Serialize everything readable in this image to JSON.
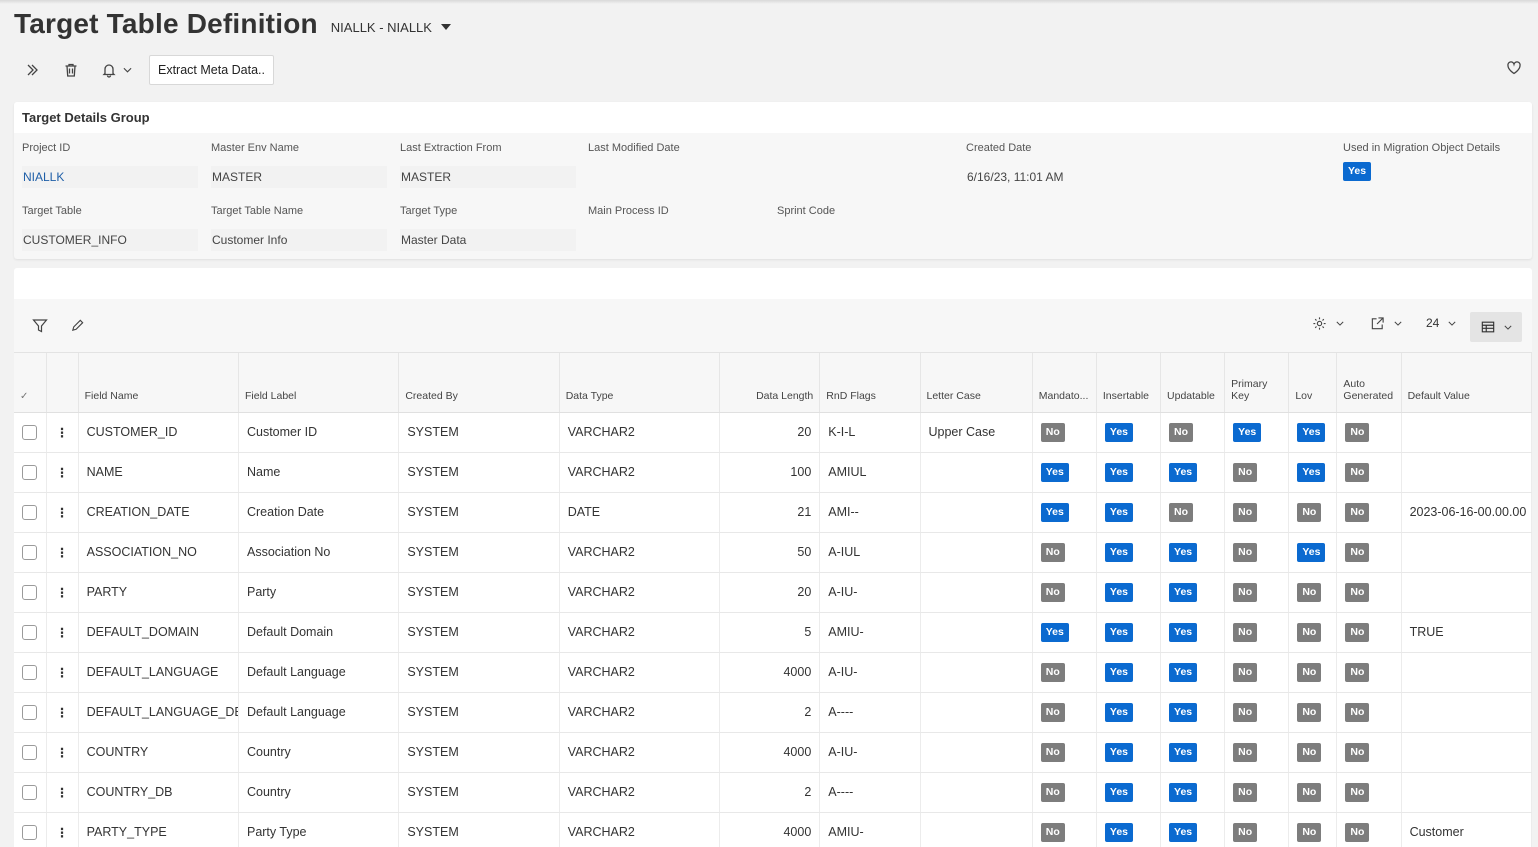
{
  "header": {
    "title": "Target Table Definition",
    "record": "NIALLK - NIALLK"
  },
  "toolbar": {
    "extract_label": "Extract Meta Data.."
  },
  "details": {
    "group_title": "Target Details Group",
    "fields": {
      "project_id": {
        "label": "Project ID",
        "value": "NIALLK"
      },
      "master_env": {
        "label": "Master Env Name",
        "value": "MASTER"
      },
      "last_extraction": {
        "label": "Last Extraction From",
        "value": "MASTER"
      },
      "last_modified": {
        "label": "Last Modified Date",
        "value": ""
      },
      "created_date": {
        "label": "Created Date",
        "value": "6/16/23, 11:01 AM"
      },
      "used_in_migration": {
        "label": "Used in Migration Object Details",
        "value": "Yes"
      },
      "target_table": {
        "label": "Target Table",
        "value": "CUSTOMER_INFO"
      },
      "target_table_name": {
        "label": "Target Table Name",
        "value": "Customer Info"
      },
      "target_type": {
        "label": "Target Type",
        "value": "Master Data"
      },
      "main_process_id": {
        "label": "Main Process ID",
        "value": ""
      },
      "sprint_code": {
        "label": "Sprint Code",
        "value": ""
      }
    }
  },
  "list": {
    "page_size": "24",
    "columns": {
      "field_name": "Field Name",
      "field_label": "Field Label",
      "created_by": "Created By",
      "data_type": "Data Type",
      "data_length": "Data Length",
      "rnd_flags": "RnD Flags",
      "letter_case": "Letter Case",
      "mandatory": "Mandato...",
      "insertable": "Insertable",
      "updatable": "Updatable",
      "primary_key": "Primary Key",
      "lov": "Lov",
      "auto_generated": "Auto Generated",
      "default_value": "Default Value"
    },
    "rows": [
      {
        "field_name": "CUSTOMER_ID",
        "field_label": "Customer ID",
        "created_by": "SYSTEM",
        "data_type": "VARCHAR2",
        "data_length": "20",
        "rnd_flags": "K-I-L",
        "letter_case": "Upper Case",
        "mandatory": "No",
        "insertable": "Yes",
        "updatable": "No",
        "primary_key": "Yes",
        "lov": "Yes",
        "auto_generated": "No",
        "default_value": ""
      },
      {
        "field_name": "NAME",
        "field_label": "Name",
        "created_by": "SYSTEM",
        "data_type": "VARCHAR2",
        "data_length": "100",
        "rnd_flags": "AMIUL",
        "letter_case": "",
        "mandatory": "Yes",
        "insertable": "Yes",
        "updatable": "Yes",
        "primary_key": "No",
        "lov": "Yes",
        "auto_generated": "No",
        "default_value": ""
      },
      {
        "field_name": "CREATION_DATE",
        "field_label": "Creation Date",
        "created_by": "SYSTEM",
        "data_type": "DATE",
        "data_length": "21",
        "rnd_flags": "AMI--",
        "letter_case": "",
        "mandatory": "Yes",
        "insertable": "Yes",
        "updatable": "No",
        "primary_key": "No",
        "lov": "No",
        "auto_generated": "No",
        "default_value": "2023-06-16-00.00.00"
      },
      {
        "field_name": "ASSOCIATION_NO",
        "field_label": "Association No",
        "created_by": "SYSTEM",
        "data_type": "VARCHAR2",
        "data_length": "50",
        "rnd_flags": "A-IUL",
        "letter_case": "",
        "mandatory": "No",
        "insertable": "Yes",
        "updatable": "Yes",
        "primary_key": "No",
        "lov": "Yes",
        "auto_generated": "No",
        "default_value": ""
      },
      {
        "field_name": "PARTY",
        "field_label": "Party",
        "created_by": "SYSTEM",
        "data_type": "VARCHAR2",
        "data_length": "20",
        "rnd_flags": "A-IU-",
        "letter_case": "",
        "mandatory": "No",
        "insertable": "Yes",
        "updatable": "Yes",
        "primary_key": "No",
        "lov": "No",
        "auto_generated": "No",
        "default_value": ""
      },
      {
        "field_name": "DEFAULT_DOMAIN",
        "field_label": "Default Domain",
        "created_by": "SYSTEM",
        "data_type": "VARCHAR2",
        "data_length": "5",
        "rnd_flags": "AMIU-",
        "letter_case": "",
        "mandatory": "Yes",
        "insertable": "Yes",
        "updatable": "Yes",
        "primary_key": "No",
        "lov": "No",
        "auto_generated": "No",
        "default_value": "TRUE"
      },
      {
        "field_name": "DEFAULT_LANGUAGE",
        "field_label": "Default Language",
        "created_by": "SYSTEM",
        "data_type": "VARCHAR2",
        "data_length": "4000",
        "rnd_flags": "A-IU-",
        "letter_case": "",
        "mandatory": "No",
        "insertable": "Yes",
        "updatable": "Yes",
        "primary_key": "No",
        "lov": "No",
        "auto_generated": "No",
        "default_value": ""
      },
      {
        "field_name": "DEFAULT_LANGUAGE_DB",
        "field_label": "Default Language",
        "created_by": "SYSTEM",
        "data_type": "VARCHAR2",
        "data_length": "2",
        "rnd_flags": "A----",
        "letter_case": "",
        "mandatory": "No",
        "insertable": "Yes",
        "updatable": "Yes",
        "primary_key": "No",
        "lov": "No",
        "auto_generated": "No",
        "default_value": ""
      },
      {
        "field_name": "COUNTRY",
        "field_label": "Country",
        "created_by": "SYSTEM",
        "data_type": "VARCHAR2",
        "data_length": "4000",
        "rnd_flags": "A-IU-",
        "letter_case": "",
        "mandatory": "No",
        "insertable": "Yes",
        "updatable": "Yes",
        "primary_key": "No",
        "lov": "No",
        "auto_generated": "No",
        "default_value": ""
      },
      {
        "field_name": "COUNTRY_DB",
        "field_label": "Country",
        "created_by": "SYSTEM",
        "data_type": "VARCHAR2",
        "data_length": "2",
        "rnd_flags": "A----",
        "letter_case": "",
        "mandatory": "No",
        "insertable": "Yes",
        "updatable": "Yes",
        "primary_key": "No",
        "lov": "No",
        "auto_generated": "No",
        "default_value": ""
      },
      {
        "field_name": "PARTY_TYPE",
        "field_label": "Party Type",
        "created_by": "SYSTEM",
        "data_type": "VARCHAR2",
        "data_length": "4000",
        "rnd_flags": "AMIU-",
        "letter_case": "",
        "mandatory": "No",
        "insertable": "Yes",
        "updatable": "Yes",
        "primary_key": "No",
        "lov": "No",
        "auto_generated": "No",
        "default_value": "Customer"
      }
    ]
  },
  "colors": {
    "yes_badge": "#0b6ad0",
    "no_badge": "#7d7d7d",
    "link": "#1f5fa8"
  }
}
